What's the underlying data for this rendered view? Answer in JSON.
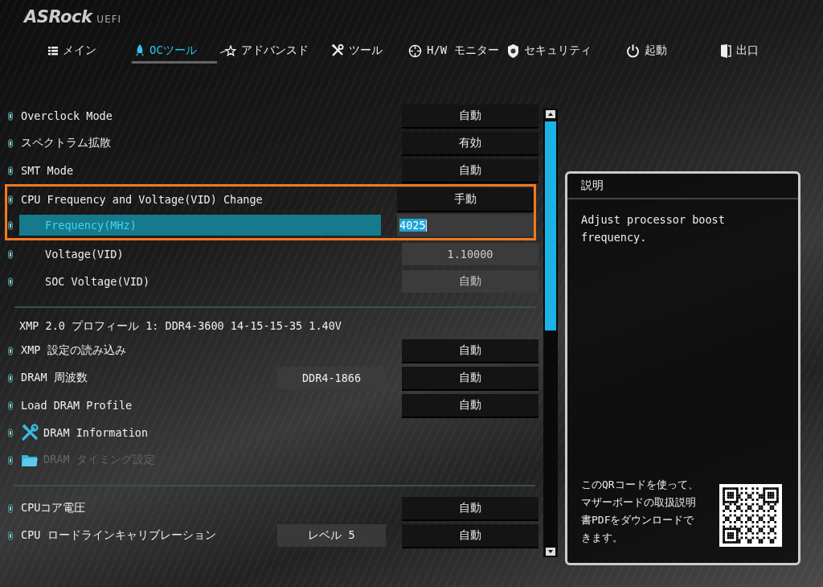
{
  "header": {
    "logo": "ASRock",
    "logo_suffix": "UEFI"
  },
  "tabs": [
    {
      "label": "メイン",
      "selected": false
    },
    {
      "label": "OCツール",
      "selected": true
    },
    {
      "label": "アドバンスド",
      "selected": false
    },
    {
      "label": "ツール",
      "selected": false
    },
    {
      "label": "H/W モニター",
      "selected": false
    },
    {
      "label": "セキュリティ",
      "selected": false
    },
    {
      "label": "起動",
      "selected": false
    },
    {
      "label": "出口",
      "selected": false
    }
  ],
  "items": [
    {
      "kind": "select",
      "label": "Overclock Mode",
      "value": "自動",
      "indent": false,
      "selected": false,
      "highlighted": false
    },
    {
      "kind": "select",
      "label": "スペクトラム拡散",
      "value": "有効",
      "indent": false,
      "selected": false,
      "highlighted": false
    },
    {
      "kind": "select",
      "label": "SMT Mode",
      "value": "自動",
      "indent": false,
      "selected": false,
      "highlighted": false
    },
    {
      "kind": "select",
      "label": "CPU Frequency and Voltage(VID) Change",
      "value": "手動",
      "indent": false,
      "selected": false,
      "highlighted": true
    },
    {
      "kind": "input",
      "label": "Frequency(MHz)",
      "value": "4025",
      "indent": true,
      "selected": true,
      "highlighted": true
    },
    {
      "kind": "input",
      "label": "Voltage(VID)",
      "value": "1.10000",
      "indent": true,
      "selected": false,
      "highlighted": false
    },
    {
      "kind": "input",
      "label": "SOC Voltage(VID)",
      "value": "自動",
      "indent": true,
      "selected": false,
      "highlighted": false
    },
    {
      "kind": "divider"
    },
    {
      "kind": "heading",
      "label": "XMP 2.0 プロフィール 1: DDR4-3600 14-15-15-35 1.40V"
    },
    {
      "kind": "select",
      "label": "XMP 設定の読み込み",
      "value": "自動",
      "indent": false,
      "selected": false,
      "highlighted": false
    },
    {
      "kind": "select",
      "label": "DRAM 周波数",
      "info": "DDR4-1866",
      "value": "自動",
      "indent": false,
      "selected": false,
      "highlighted": false
    },
    {
      "kind": "select",
      "label": "Load DRAM Profile",
      "value": "自動",
      "indent": false,
      "selected": false,
      "highlighted": false
    },
    {
      "kind": "tools",
      "label": "DRAM Information",
      "disabled": false
    },
    {
      "kind": "folder",
      "label": "DRAM タイミング設定",
      "disabled": true
    },
    {
      "kind": "divider"
    },
    {
      "kind": "select",
      "label": "CPUコア電圧",
      "value": "自動",
      "indent": false,
      "selected": false,
      "highlighted": false
    },
    {
      "kind": "select",
      "label": "CPU ロードラインキャリブレーション",
      "info": "レベル 5",
      "value": "自動",
      "indent": false,
      "selected": false,
      "highlighted": false
    }
  ],
  "help_panel": {
    "title": "説明",
    "description": "Adjust processor boost frequency.",
    "qr_text": "このQRコードを使って、マザーボードの取扱説明書PDFをダウンロードできます。"
  }
}
